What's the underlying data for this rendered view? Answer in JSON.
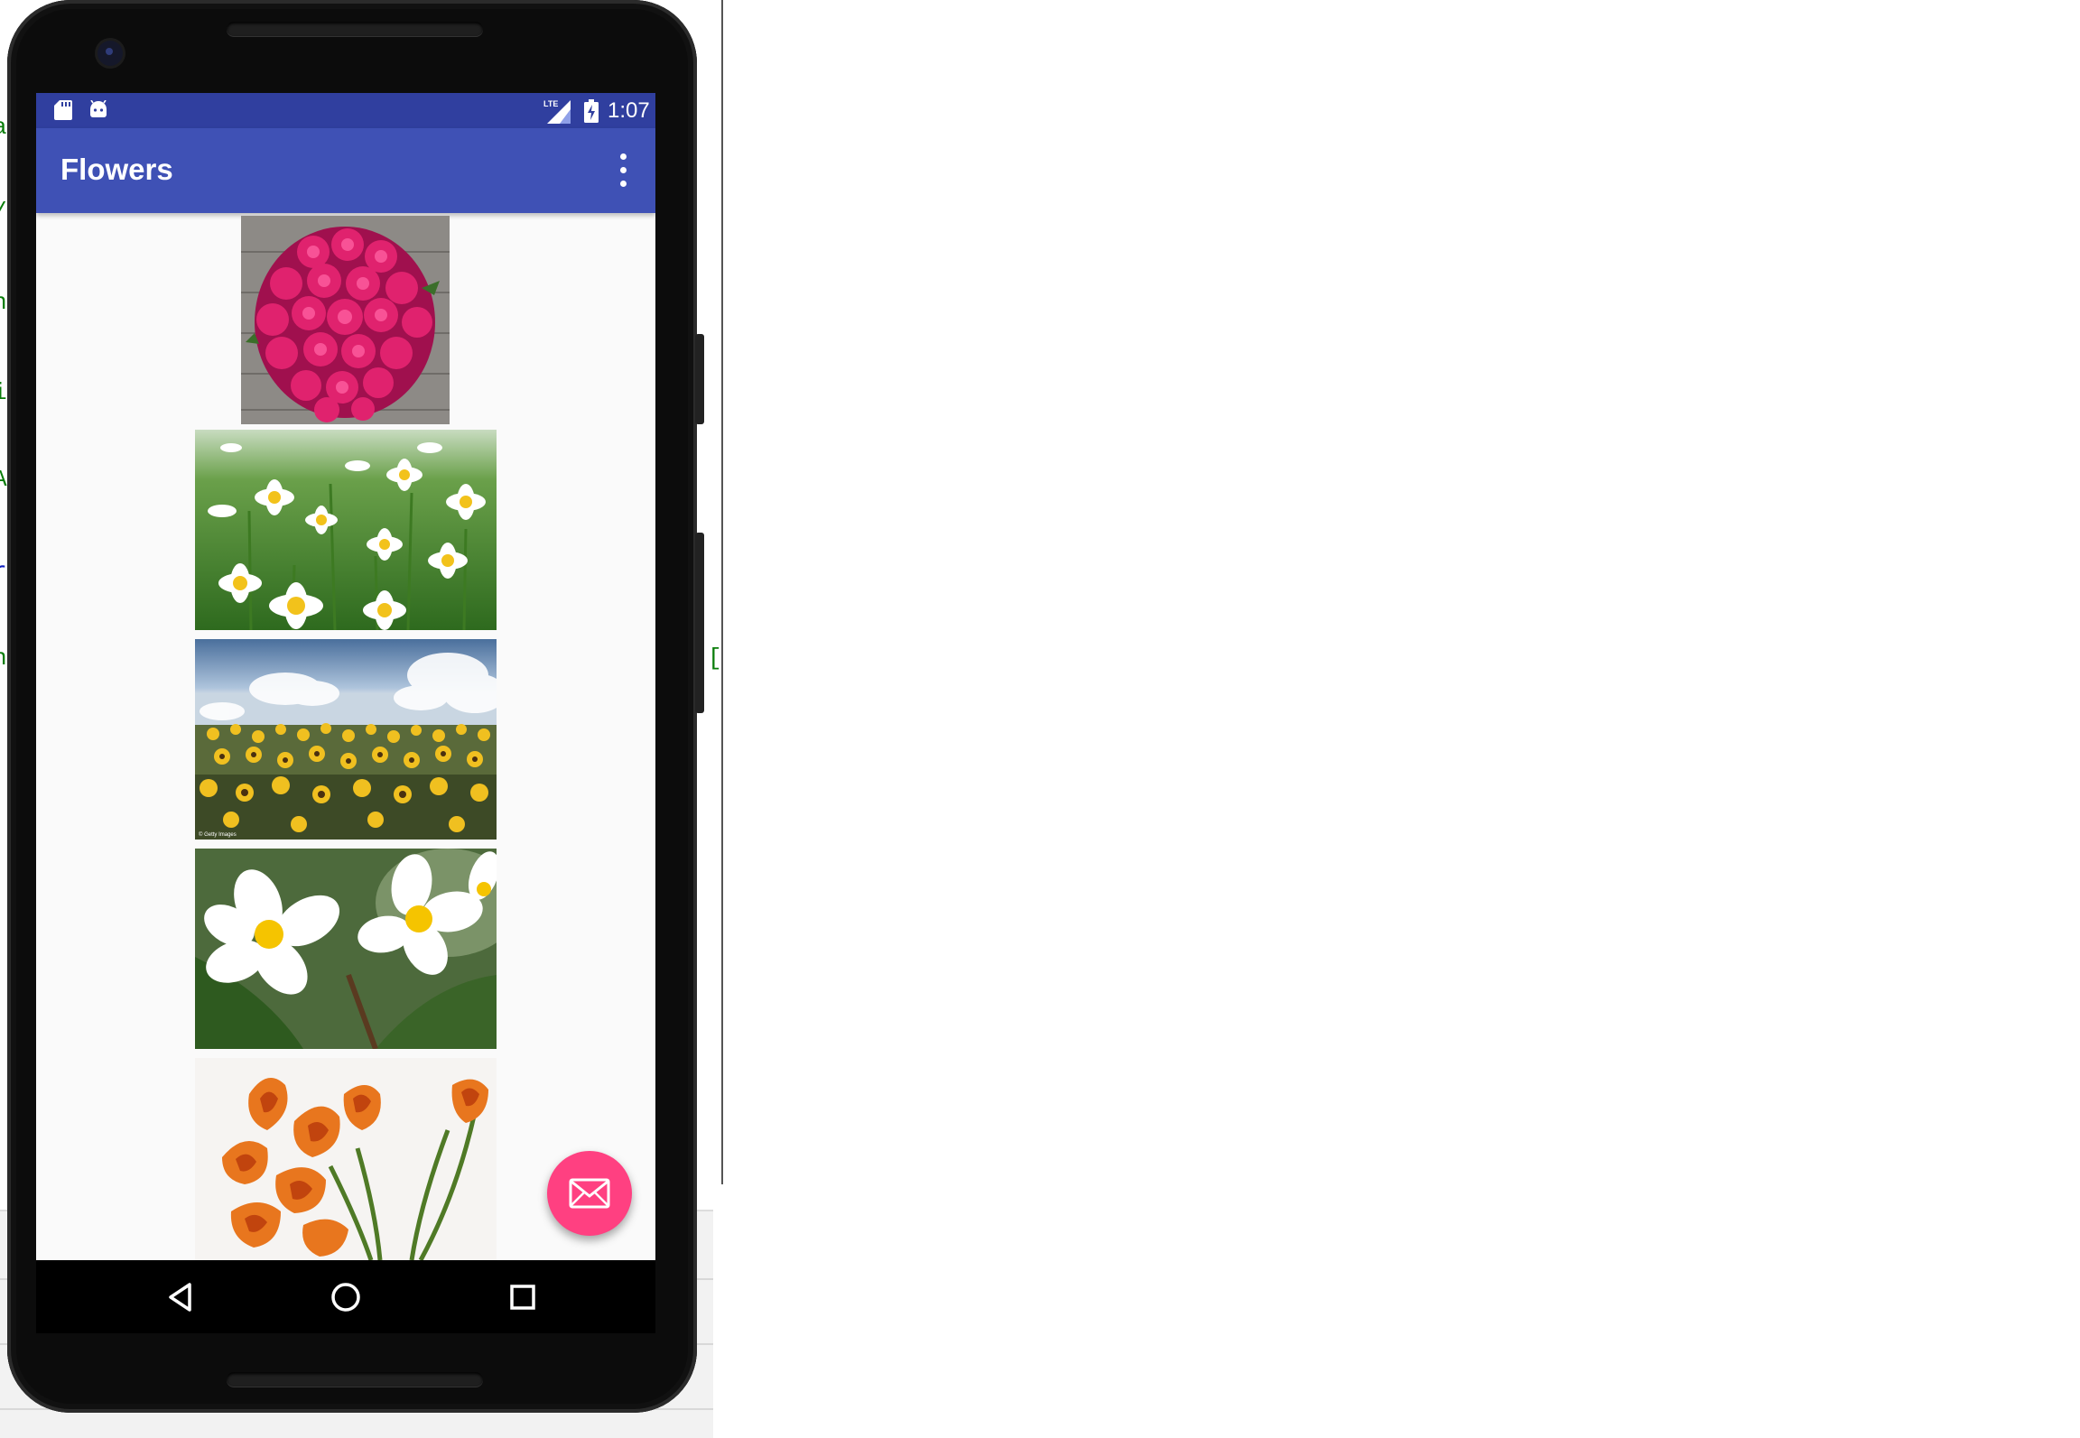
{
  "status_bar": {
    "time": "1:07",
    "network_label": "LTE",
    "icons": [
      "sd-card-icon",
      "android-notification-icon",
      "lte-signal-icon",
      "battery-charging-icon"
    ]
  },
  "app_bar": {
    "title": "Flowers",
    "overflow_icon": "more-vert-icon"
  },
  "gallery": {
    "images": [
      {
        "subject": "pink roses bouquet on wooden planks"
      },
      {
        "subject": "white daisies in green meadow"
      },
      {
        "subject": "sunflower field under cloudy sky",
        "credit": "© Getty Images"
      },
      {
        "subject": "white and yellow plumeria flowers"
      },
      {
        "subject": "orange calla lilies"
      }
    ]
  },
  "fab": {
    "icon": "email-icon"
  },
  "nav_bar": {
    "icons": [
      "back-icon",
      "home-icon",
      "recents-icon"
    ]
  },
  "colors": {
    "primary": "#3f51b5",
    "primary_dark": "#303f9f",
    "accent": "#ff4081",
    "background": "#fafafa"
  }
}
